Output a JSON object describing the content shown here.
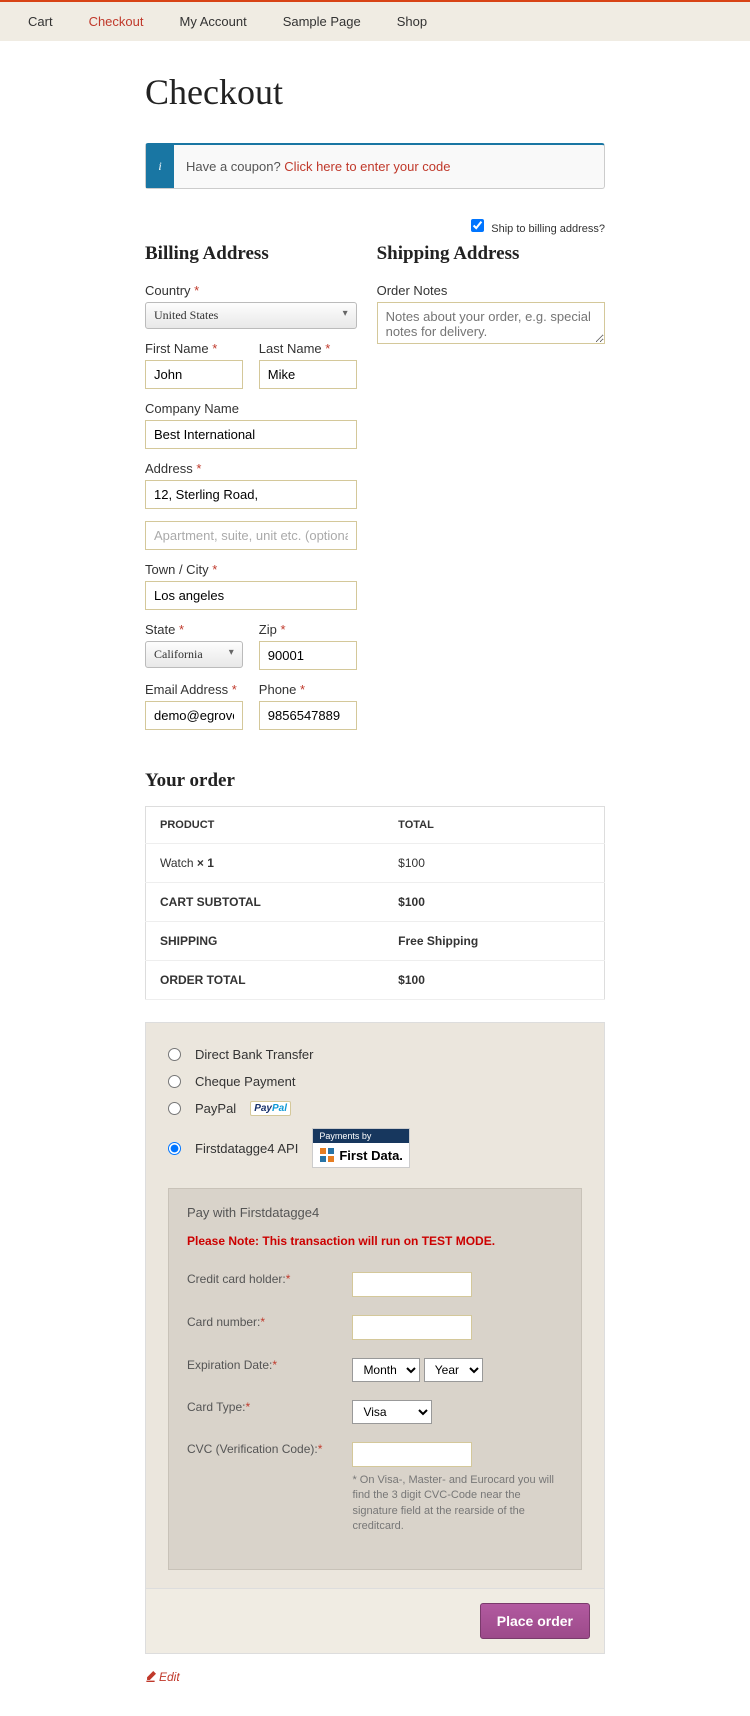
{
  "nav": {
    "items": [
      "Cart",
      "Checkout",
      "My Account",
      "Sample Page",
      "Shop"
    ],
    "active": 1
  },
  "page_title": "Checkout",
  "coupon": {
    "icon": "i",
    "prompt": "Have a coupon? ",
    "link": "Click here to enter your code"
  },
  "ship_to_billing": {
    "label": "Ship to billing address?",
    "checked": true
  },
  "billing": {
    "heading": "Billing Address",
    "country_label": "Country",
    "country_value": "United States",
    "first_name_label": "First Name",
    "first_name": "John",
    "last_name_label": "Last Name",
    "last_name": "Mike",
    "company_label": "Company Name",
    "company": "Best International",
    "address_label": "Address",
    "address1": "12, Sterling Road,",
    "address2_ph": "Apartment, suite, unit etc. (optional)",
    "city_label": "Town / City",
    "city": "Los angeles",
    "state_label": "State",
    "state": "California",
    "zip_label": "Zip",
    "zip": "90001",
    "email_label": "Email Address",
    "email": "demo@egrovetec",
    "phone_label": "Phone",
    "phone": "9856547889"
  },
  "shipping": {
    "heading": "Shipping Address",
    "notes_label": "Order Notes",
    "notes_ph": "Notes about your order, e.g. special notes for delivery."
  },
  "order": {
    "heading": "Your order",
    "head_product": "Product",
    "head_total": "Total",
    "item_name": "Watch",
    "item_qty": "× 1",
    "item_total": "$100",
    "subtotal_label": "Cart Subtotal",
    "subtotal": "$100",
    "shipping_label": "Shipping",
    "shipping": "Free Shipping",
    "total_label": "Order Total",
    "total": "$100"
  },
  "payment": {
    "opts": {
      "bank": "Direct Bank Transfer",
      "cheque": "Cheque Payment",
      "paypal": "PayPal",
      "fd": "Firstdatagge4 API"
    },
    "fd_badge_top": "Payments by",
    "fd_badge_text": "First Data.",
    "panel_title": "Pay with Firstdatagge4",
    "warn": "Please Note: This transaction will run on TEST MODE.",
    "holder_label": "Credit card holder:",
    "number_label": "Card number:",
    "exp_label": "Expiration Date:",
    "exp_month": "Month",
    "exp_year": "Year",
    "type_label": "Card Type:",
    "type_value": "Visa",
    "cvc_label": "CVC (Verification Code):",
    "cvc_note": "* On Visa-, Master- and Eurocard you will find the 3 digit CVC-Code near the signature field at the rearside of the creditcard."
  },
  "place_order": "Place order",
  "edit": "Edit"
}
